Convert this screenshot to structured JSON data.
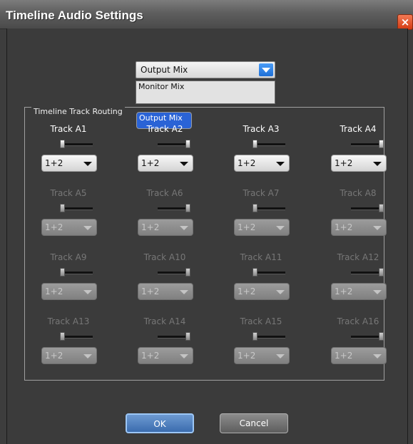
{
  "window": {
    "title": "Timeline Audio Settings",
    "close_glyph": "×"
  },
  "mix": {
    "selected": "Output Mix",
    "options": [
      "Output Mix",
      "Monitor Mix"
    ]
  },
  "routing": {
    "group_label": "Timeline Track Routing"
  },
  "tracks": [
    {
      "name": "Track A1",
      "routing": "1+2",
      "enabled": true,
      "pan": "left"
    },
    {
      "name": "Track A2",
      "routing": "1+2",
      "enabled": true,
      "pan": "right"
    },
    {
      "name": "Track A3",
      "routing": "1+2",
      "enabled": true,
      "pan": "left"
    },
    {
      "name": "Track A4",
      "routing": "1+2",
      "enabled": true,
      "pan": "right"
    },
    {
      "name": "Track A5",
      "routing": "1+2",
      "enabled": false,
      "pan": "left"
    },
    {
      "name": "Track A6",
      "routing": "1+2",
      "enabled": false,
      "pan": "right"
    },
    {
      "name": "Track A7",
      "routing": "1+2",
      "enabled": false,
      "pan": "left"
    },
    {
      "name": "Track A8",
      "routing": "1+2",
      "enabled": false,
      "pan": "right"
    },
    {
      "name": "Track A9",
      "routing": "1+2",
      "enabled": false,
      "pan": "left"
    },
    {
      "name": "Track A10",
      "routing": "1+2",
      "enabled": false,
      "pan": "right"
    },
    {
      "name": "Track A11",
      "routing": "1+2",
      "enabled": false,
      "pan": "left"
    },
    {
      "name": "Track A12",
      "routing": "1+2",
      "enabled": false,
      "pan": "right"
    },
    {
      "name": "Track A13",
      "routing": "1+2",
      "enabled": false,
      "pan": "left"
    },
    {
      "name": "Track A14",
      "routing": "1+2",
      "enabled": false,
      "pan": "right"
    },
    {
      "name": "Track A15",
      "routing": "1+2",
      "enabled": false,
      "pan": "left"
    },
    {
      "name": "Track A16",
      "routing": "1+2",
      "enabled": false,
      "pan": "right"
    }
  ],
  "buttons": {
    "ok": "OK",
    "cancel": "Cancel"
  },
  "icons": {
    "close": "close-icon",
    "dropdown": "chevron-down-icon",
    "pan": "pan-slider"
  },
  "colors": {
    "dialog_bg": "#3b3b3b",
    "title_text": "#ffffff",
    "close_button": "#d33a12",
    "dropdown_arrow": "#1e6fd6",
    "list_highlight": "#2a63d6",
    "ok_button": "#3b6cae",
    "disabled_text": "#777777"
  }
}
